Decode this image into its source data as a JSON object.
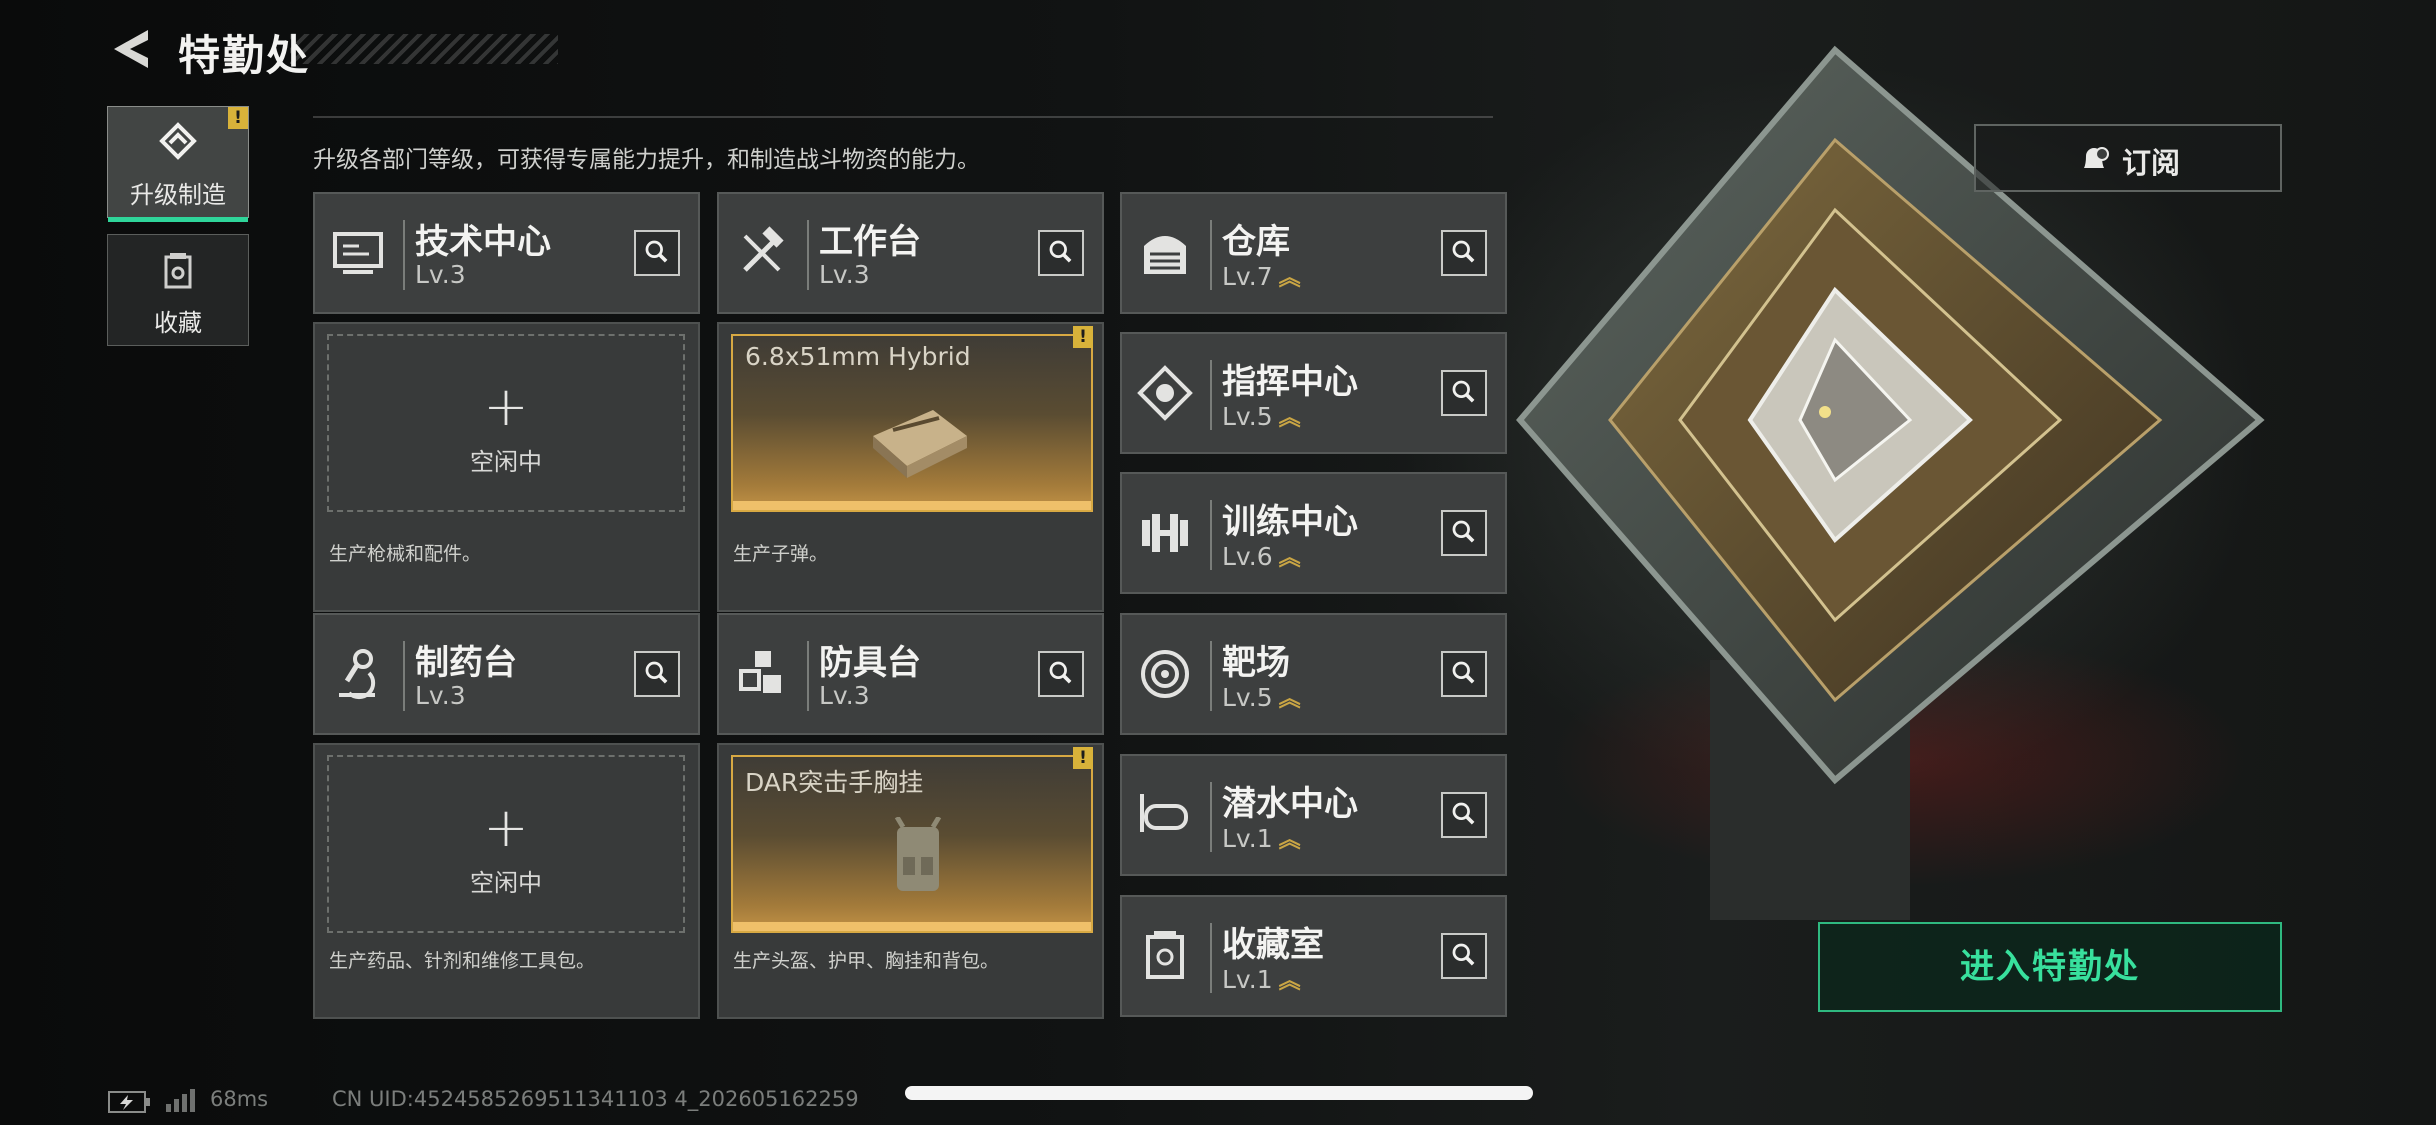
{
  "header": {
    "title": "特勤处",
    "description": "升级各部门等级，可获得专属能力提升，和制造战斗物资的能力。"
  },
  "sidebar": {
    "items": [
      {
        "label": "升级制造",
        "icon": "upgrade-icon",
        "badge": "!"
      },
      {
        "label": "收藏",
        "icon": "collection-icon"
      }
    ]
  },
  "departments": {
    "tech": {
      "name": "技术中心",
      "level": "Lv.3",
      "status": "空闲中",
      "plus": "+",
      "desc": "生产枪械和配件。"
    },
    "workbench": {
      "name": "工作台",
      "level": "Lv.3",
      "product": "6.8x51mm Hybrid",
      "badge": "!",
      "desc": "生产子弹。"
    },
    "pharmacy": {
      "name": "制药台",
      "level": "Lv.3",
      "status": "空闲中",
      "plus": "+",
      "desc": "生产药品、针剂和维修工具包。"
    },
    "armor": {
      "name": "防具台",
      "level": "Lv.3",
      "product": "DAR突击手胸挂",
      "badge": "!",
      "desc": "生产头盔、护甲、胸挂和背包。"
    },
    "warehouse": {
      "name": "仓库",
      "level": "Lv.7"
    },
    "command": {
      "name": "指挥中心",
      "level": "Lv.5"
    },
    "training": {
      "name": "训练中心",
      "level": "Lv.6"
    },
    "range": {
      "name": "靶场",
      "level": "Lv.5"
    },
    "diving": {
      "name": "潜水中心",
      "level": "Lv.1"
    },
    "collection": {
      "name": "收藏室",
      "level": "Lv.1"
    }
  },
  "right_panel": {
    "subscribe_label": "订阅",
    "enter_label": "进入特勤处"
  },
  "footer": {
    "ping": "68ms",
    "uid": "CN UID:4524585269511341103 4_202605162259"
  },
  "colors": {
    "accent_green": "#2fd59a",
    "gold": "#d8a943",
    "panel": "#3d3f3f"
  }
}
